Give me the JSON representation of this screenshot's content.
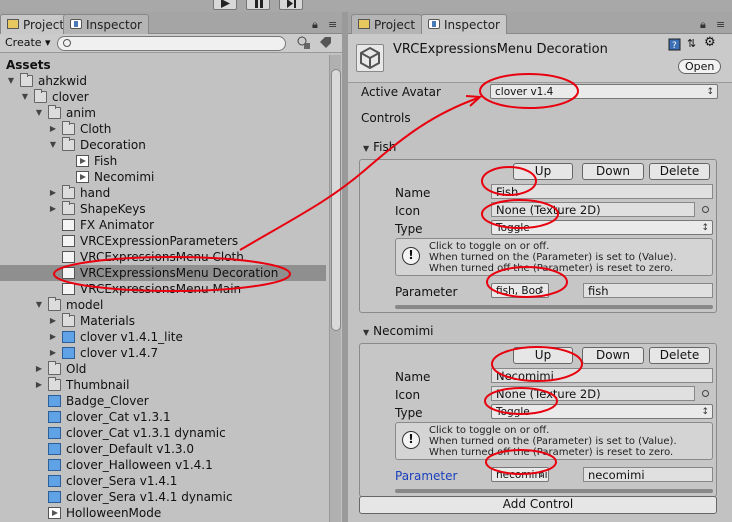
{
  "project_panel": {
    "tabs": [
      {
        "label": "Project",
        "active": true
      },
      {
        "label": "Inspector",
        "active": false
      }
    ],
    "create_label": "Create",
    "search_placeholder": "",
    "root": "Assets",
    "tree": [
      {
        "label": "ahzkwid",
        "depth": 1,
        "type": "folder",
        "expanded": true
      },
      {
        "label": "clover",
        "depth": 2,
        "type": "folder",
        "expanded": true
      },
      {
        "label": "anim",
        "depth": 3,
        "type": "folder",
        "expanded": true
      },
      {
        "label": "Cloth",
        "depth": 4,
        "type": "folder",
        "expanded": false
      },
      {
        "label": "Decoration",
        "depth": 4,
        "type": "folder",
        "expanded": true
      },
      {
        "label": "Fish",
        "depth": 5,
        "type": "anim"
      },
      {
        "label": "Necomimi",
        "depth": 5,
        "type": "anim"
      },
      {
        "label": "hand",
        "depth": 4,
        "type": "folder",
        "expanded": false
      },
      {
        "label": "ShapeKeys",
        "depth": 4,
        "type": "folder",
        "expanded": false
      },
      {
        "label": "FX Animator",
        "depth": 4,
        "type": "script"
      },
      {
        "label": "VRCExpressionParameters",
        "depth": 4,
        "type": "script"
      },
      {
        "label": "VRCExpressionsMenu Cloth",
        "depth": 4,
        "type": "script"
      },
      {
        "label": "VRCExpressionsMenu Decoration",
        "depth": 4,
        "type": "script",
        "selected": true
      },
      {
        "label": "VRCExpressionsMenu Main",
        "depth": 4,
        "type": "script"
      },
      {
        "label": "model",
        "depth": 3,
        "type": "folder",
        "expanded": true
      },
      {
        "label": "Materials",
        "depth": 4,
        "type": "folder",
        "expanded": false
      },
      {
        "label": "clover v1.4.1_lite",
        "depth": 4,
        "type": "cube",
        "arrow": true
      },
      {
        "label": "clover v1.4.7",
        "depth": 4,
        "type": "cube",
        "arrow": true
      },
      {
        "label": "Old",
        "depth": 3,
        "type": "folder",
        "expanded": false
      },
      {
        "label": "Thumbnail",
        "depth": 3,
        "type": "folder",
        "expanded": false
      },
      {
        "label": "Badge_Clover",
        "depth": 3,
        "type": "cube"
      },
      {
        "label": "clover_Cat v1.3.1",
        "depth": 3,
        "type": "cube"
      },
      {
        "label": "clover_Cat v1.3.1 dynamic",
        "depth": 3,
        "type": "cube"
      },
      {
        "label": "clover_Default v1.3.0",
        "depth": 3,
        "type": "cube"
      },
      {
        "label": "clover_Halloween v1.4.1",
        "depth": 3,
        "type": "cube"
      },
      {
        "label": "clover_Sera v1.4.1",
        "depth": 3,
        "type": "cube"
      },
      {
        "label": "clover_Sera v1.4.1 dynamic",
        "depth": 3,
        "type": "cube"
      },
      {
        "label": "HolloweenMode",
        "depth": 3,
        "type": "anim"
      }
    ]
  },
  "inspector": {
    "tabs": [
      {
        "label": "Project",
        "active": false
      },
      {
        "label": "Inspector",
        "active": true
      }
    ],
    "title": "VRCExpressionsMenu Decoration",
    "open_label": "Open",
    "active_avatar_label": "Active Avatar",
    "active_avatar_value": "clover v1.4",
    "controls_label": "Controls",
    "buttons": {
      "up": "Up",
      "down": "Down",
      "delete": "Delete"
    },
    "controls": [
      {
        "foldout": "Fish",
        "name_label": "Name",
        "name": "Fish",
        "icon_label": "Icon",
        "icon": "None (Texture 2D)",
        "type_label": "Type",
        "type": "Toggle",
        "help": "Click to toggle on or off.\nWhen turned on the (Parameter) is set to (Value).\nWhen turned off the (Parameter) is reset to zero.",
        "parameter_label": "Parameter",
        "parameter_popup": "fish, Boo",
        "parameter_value": "fish"
      },
      {
        "foldout": "Necomimi",
        "name_label": "Name",
        "name": "Necomimi",
        "icon_label": "Icon",
        "icon": "None (Texture 2D)",
        "type_label": "Type",
        "type": "Toggle",
        "help": "Click to toggle on or off.\nWhen turned on the (Parameter) is set to (Value).\nWhen turned off the (Parameter) is reset to zero.",
        "parameter_label": "Parameter",
        "parameter_popup": "necomimi",
        "parameter_value": "necomimi"
      }
    ],
    "add_control_label": "Add Control"
  },
  "colors": {
    "annotation": "#e8000f",
    "selection": "#8f8f8f",
    "parameter_blue": "#1a3fbf"
  }
}
